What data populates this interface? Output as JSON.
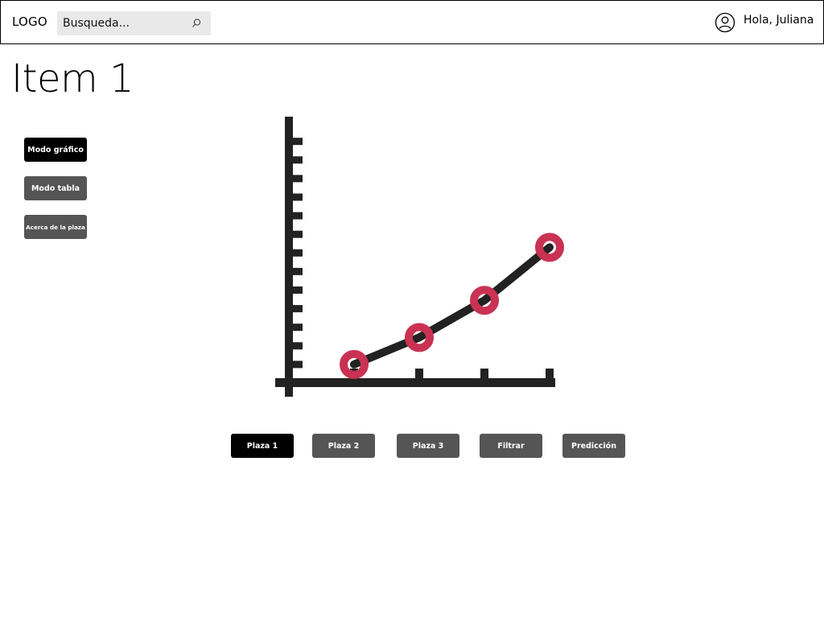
{
  "header": {
    "logo": "LOGO",
    "search": {
      "placeholder": "Busqueda..."
    },
    "user": {
      "greeting": "Hola, Juliana"
    }
  },
  "page": {
    "title": "Item 1"
  },
  "sidebar": {
    "buttons": [
      {
        "label": "Modo gráfico",
        "active": true
      },
      {
        "label": "Modo tabla",
        "active": false
      },
      {
        "label": "Acerca de la plaza",
        "active": false
      }
    ]
  },
  "chart_data": {
    "type": "line",
    "x": [
      1,
      2,
      3,
      4
    ],
    "values": [
      1,
      2.45,
      4.45,
      7.3
    ],
    "xlim": [
      0,
      4.3
    ],
    "ylim": [
      0,
      13
    ],
    "line_color": "#222222",
    "marker_color": "#c93253"
  },
  "bottom_tabs": [
    {
      "label": "Plaza 1",
      "active": true
    },
    {
      "label": "Plaza 2",
      "active": false
    },
    {
      "label": "Plaza 3",
      "active": false
    },
    {
      "label": "Filtrar",
      "active": false
    },
    {
      "label": "Predicción",
      "active": false
    }
  ],
  "colors": {
    "active_button": "#000000",
    "inactive_button": "#555555",
    "search_bg": "#e9e9e9"
  }
}
